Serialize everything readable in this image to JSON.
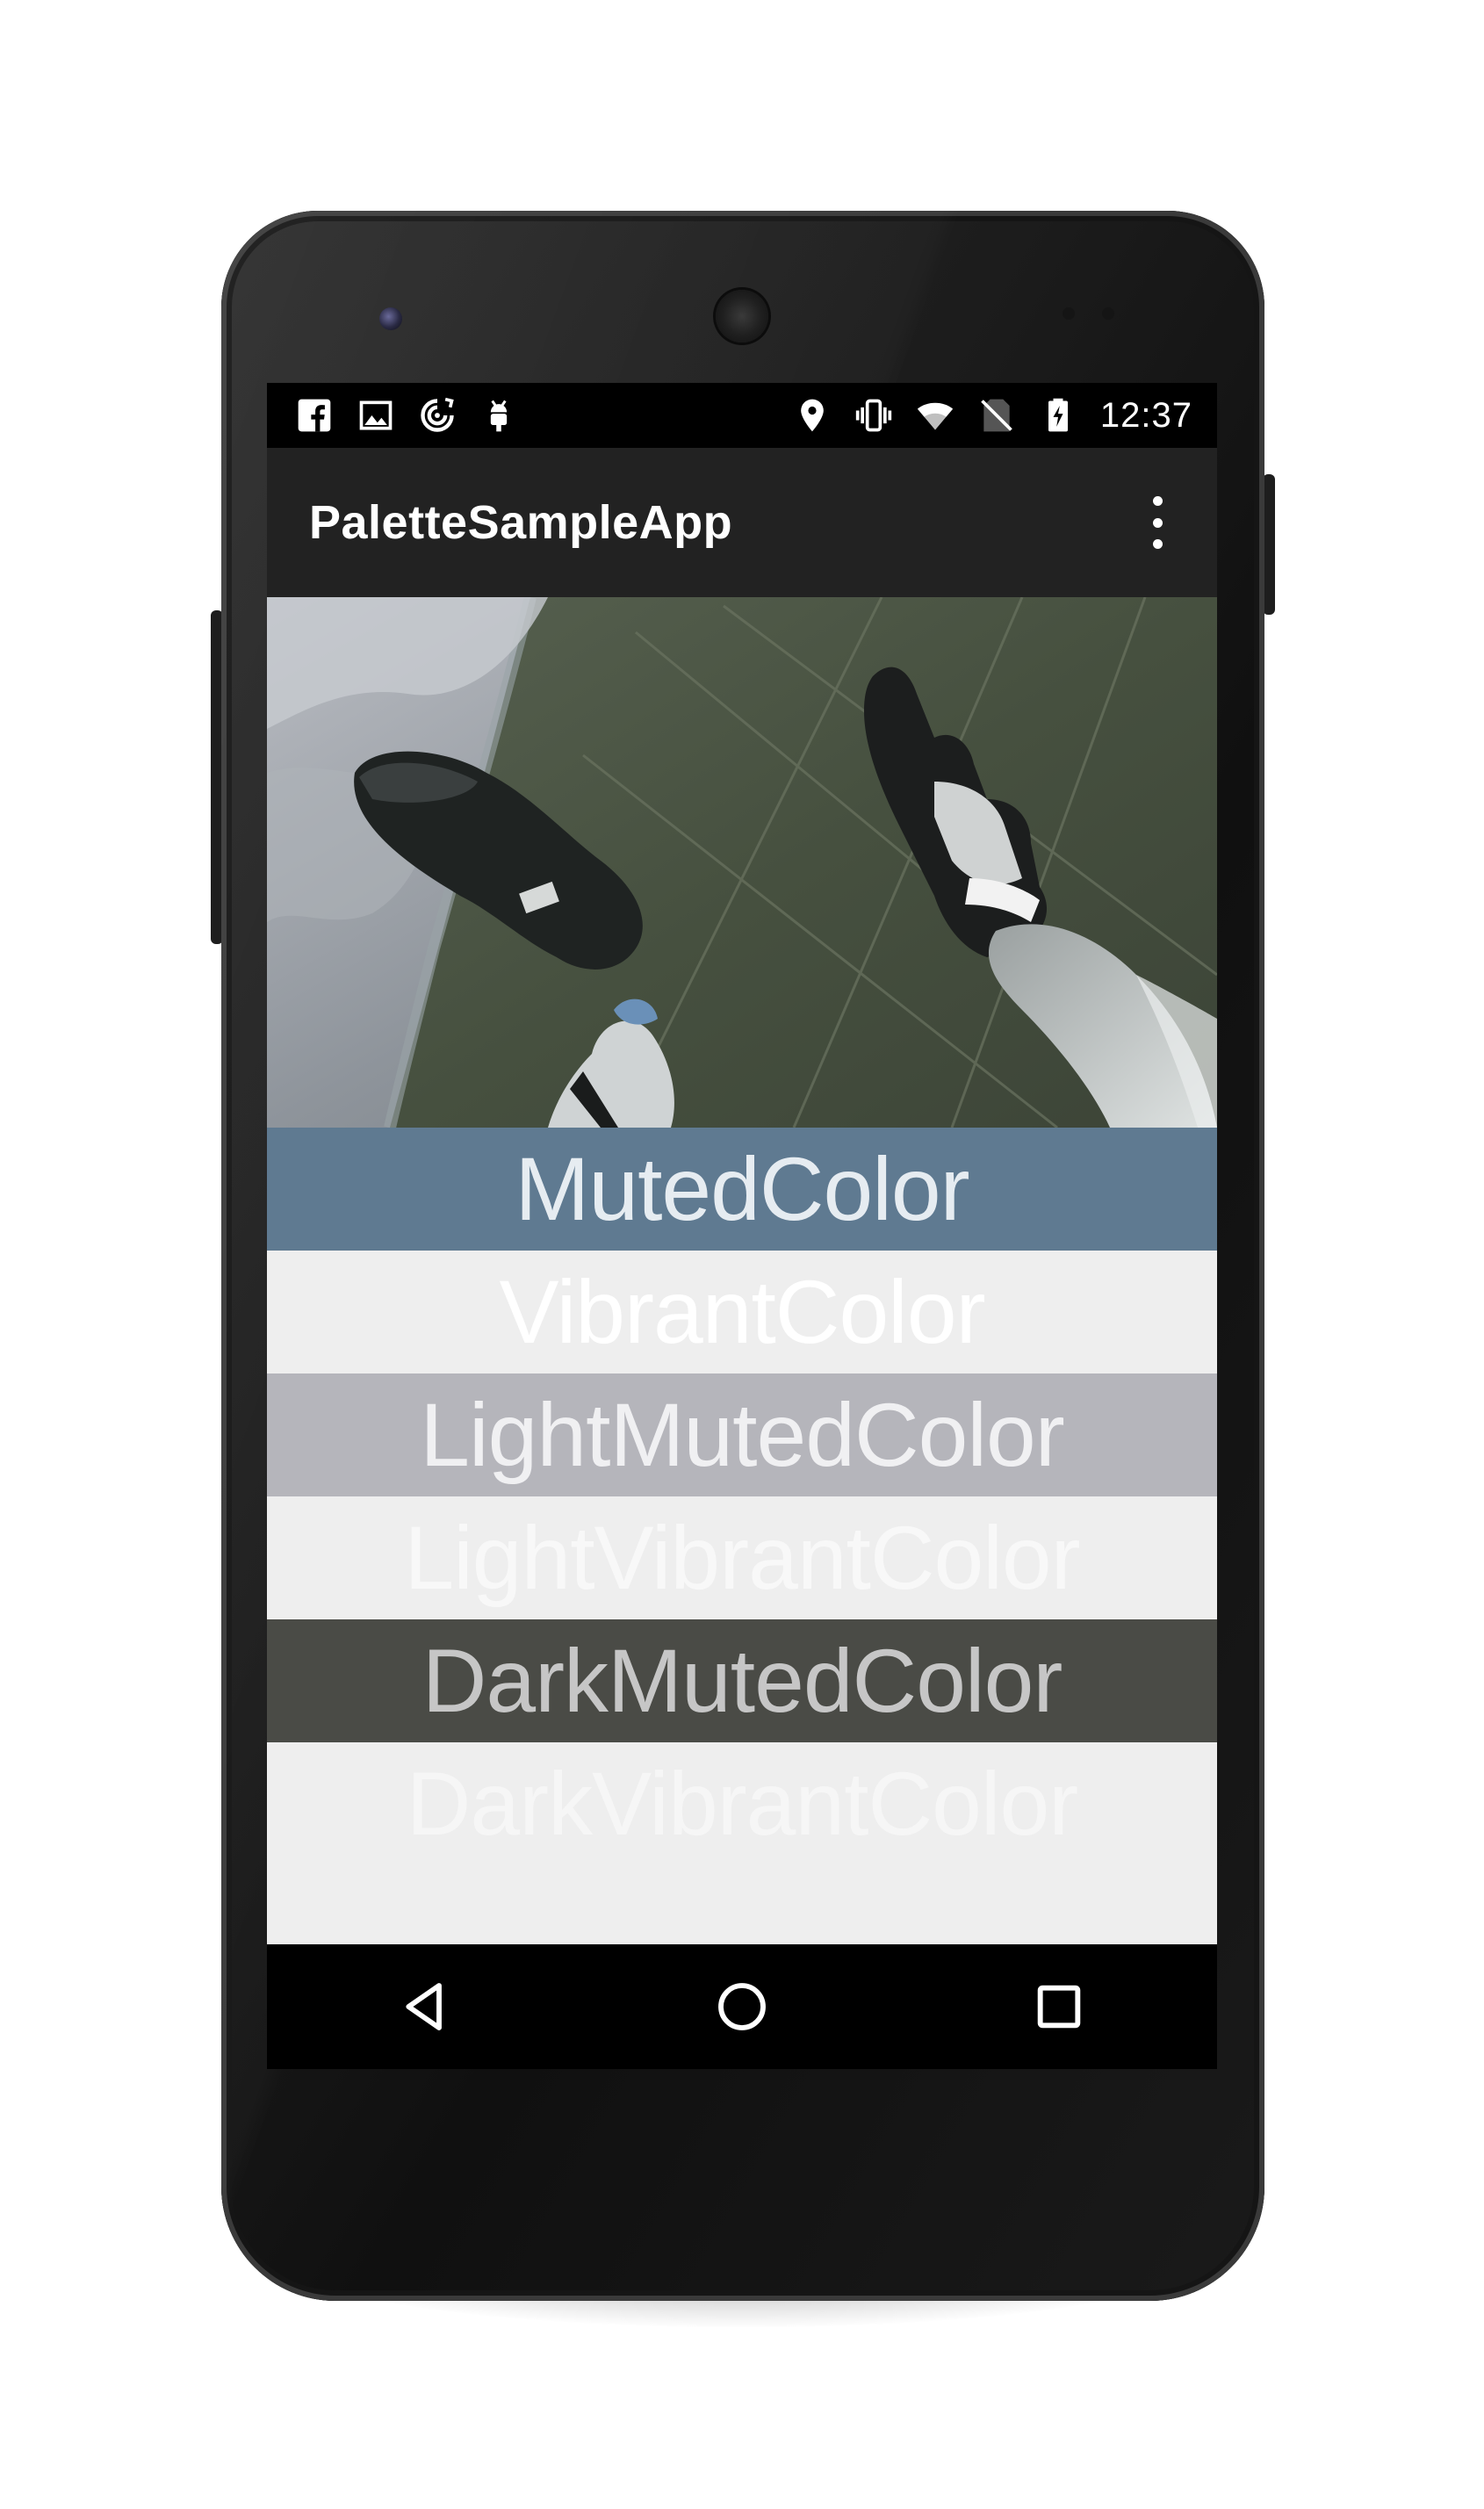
{
  "status_bar": {
    "time": "12:37",
    "left_icons": [
      "facebook-icon",
      "image-icon",
      "sync-icon",
      "android-debug-icon"
    ],
    "right_icons": [
      "location-icon",
      "vibrate-icon",
      "wifi-icon",
      "no-sim-icon",
      "battery-charging-icon"
    ]
  },
  "app_bar": {
    "title": "PaletteSampleApp",
    "overflow_icon": "more-vert-icon"
  },
  "swatches": [
    {
      "label": "MutedColor",
      "background": "#5f7a91",
      "text_color": "#e6ecf1"
    },
    {
      "label": "VibrantColor",
      "background": "#eeeeee",
      "text_color": "#ffffff"
    },
    {
      "label": "LightMutedColor",
      "background": "#b5b5bb",
      "text_color": "#f0f0f2"
    },
    {
      "label": "LightVibrantColor",
      "background": "#eeeeee",
      "text_color": "#f8f8f8"
    },
    {
      "label": "DarkMutedColor",
      "background": "#4a4b46",
      "text_color": "#c6c6c6"
    },
    {
      "label": "DarkVibrantColor",
      "background": "#eeeeee",
      "text_color": "#f6f6f6"
    }
  ],
  "nav_bar": {
    "back_icon": "back-triangle-icon",
    "home_icon": "home-circle-icon",
    "recents_icon": "recents-square-icon"
  }
}
